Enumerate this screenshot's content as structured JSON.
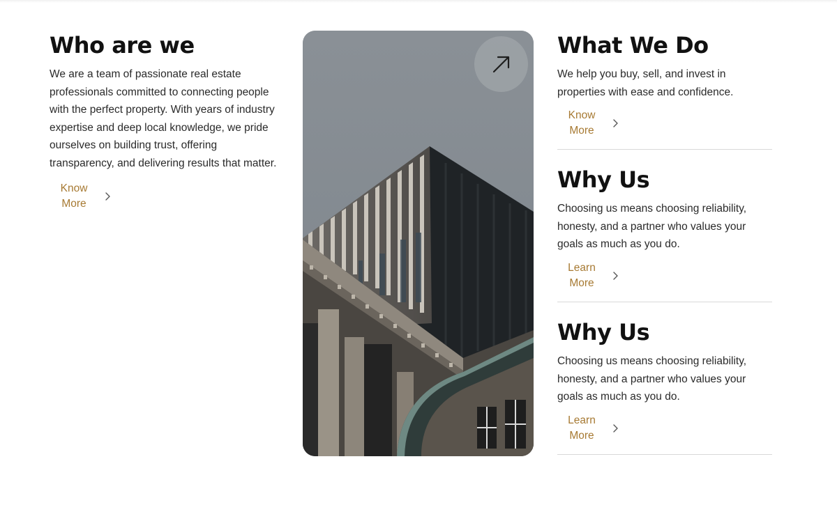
{
  "who": {
    "title": "Who are we",
    "body": "We are a team of passionate real estate professionals committed to connecting people with the perfect property. With years of industry expertise and deep local knowledge, we pride ourselves on building trust, offering transparency, and delivering results that matter.",
    "link_label": "Know More"
  },
  "image_card": {
    "arrow_icon": "arrow-up-right-icon"
  },
  "right": {
    "blocks": [
      {
        "title": "What We Do",
        "body": "We help you buy, sell, and invest in properties with ease and confidence.",
        "link_label": "Know More"
      },
      {
        "title": "Why Us",
        "body": "Choosing us means choosing reliability, honesty, and a partner who values your goals as much as you do.",
        "link_label": "Learn More"
      },
      {
        "title": "Why Us",
        "body": "Choosing us means choosing reliability, honesty, and a partner who values your goals as much as you do.",
        "link_label": "Learn More"
      }
    ]
  },
  "colors": {
    "accent": "#a77a33",
    "heading": "#111111",
    "body_text": "#2a2a2a",
    "divider": "#d8d8d8",
    "sky": "#868d93"
  }
}
